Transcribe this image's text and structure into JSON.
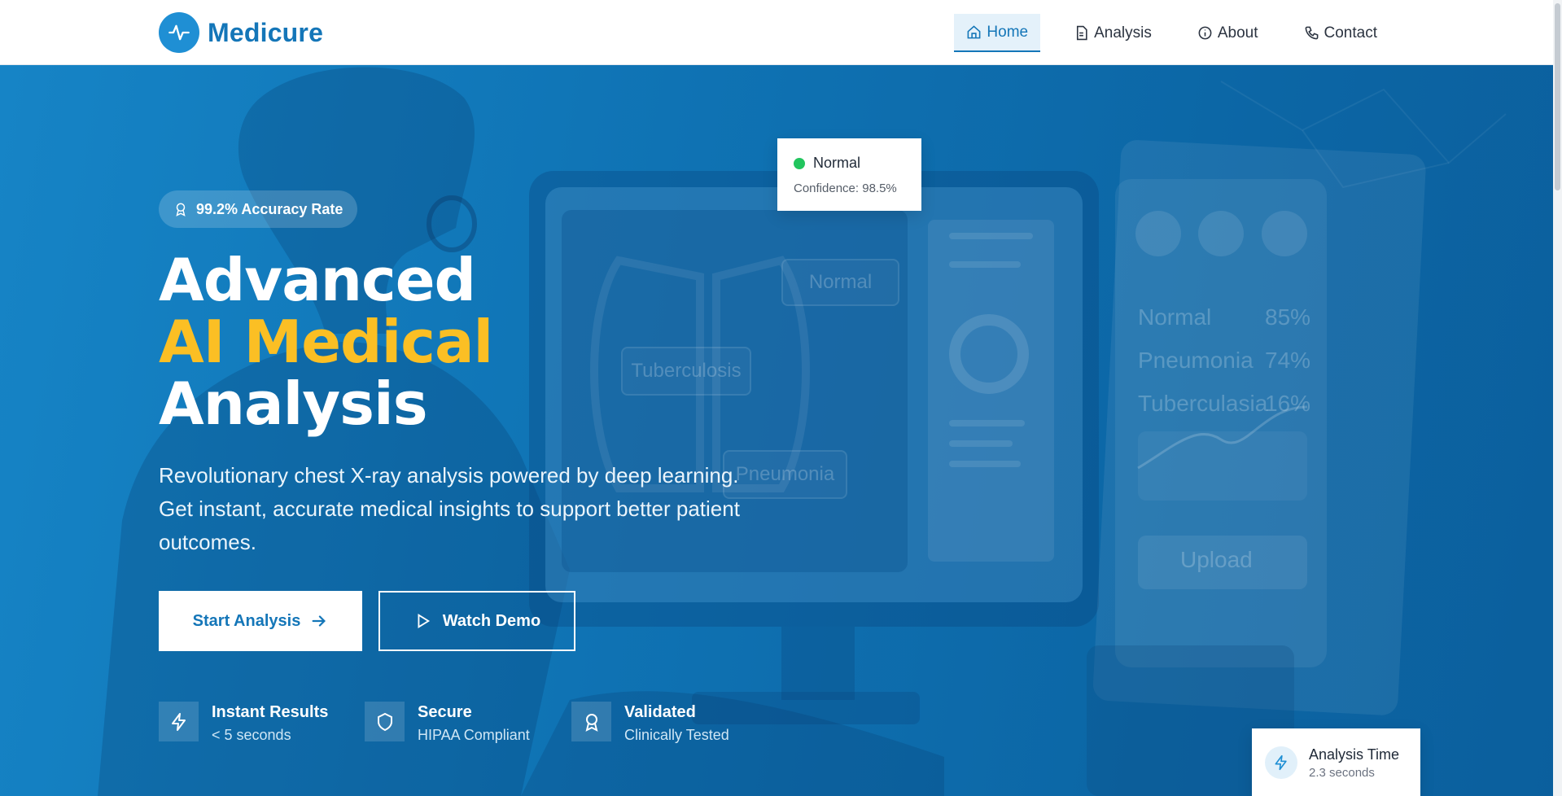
{
  "brand": {
    "name": "Medicure"
  },
  "nav": {
    "items": [
      {
        "label": "Home",
        "icon": "home-icon",
        "active": true
      },
      {
        "label": "Analysis",
        "icon": "document-icon",
        "active": false
      },
      {
        "label": "About",
        "icon": "info-icon",
        "active": false
      },
      {
        "label": "Contact",
        "icon": "phone-icon",
        "active": false
      }
    ]
  },
  "hero": {
    "badge": "99.2% Accuracy Rate",
    "headline": {
      "line1": "Advanced",
      "line2": "AI Medical",
      "line3": "Analysis"
    },
    "description": "Revolutionary chest X-ray analysis powered by deep learning. Get instant, accurate medical insights to support better patient outcomes.",
    "primary_button": "Start Analysis",
    "secondary_button": "Watch Demo",
    "features": [
      {
        "title": "Instant Results",
        "subtitle": "< 5 seconds",
        "icon": "lightning-icon"
      },
      {
        "title": "Secure",
        "subtitle": "HIPAA Compliant",
        "icon": "shield-icon"
      },
      {
        "title": "Validated",
        "subtitle": "Clinically Tested",
        "icon": "award-icon"
      }
    ]
  },
  "result_card": {
    "status": "Normal",
    "confidence": "Confidence: 98.5%"
  },
  "time_card": {
    "title": "Analysis Time",
    "value": "2.3 seconds"
  },
  "illustration": {
    "labels": [
      "Normal",
      "Tuberculosis",
      "Pneumonia"
    ],
    "panel_rows": [
      {
        "label": "Normal",
        "value": "85%"
      },
      {
        "label": "Pneumonia",
        "value": "74%"
      },
      {
        "label": "Tuberculasia",
        "value": "16%"
      }
    ],
    "upload_label": "Upload"
  },
  "colors": {
    "brand": "#1476b8",
    "accent": "#fbbf24",
    "success": "#22c55e",
    "hero_bg": "#0f73b4"
  }
}
